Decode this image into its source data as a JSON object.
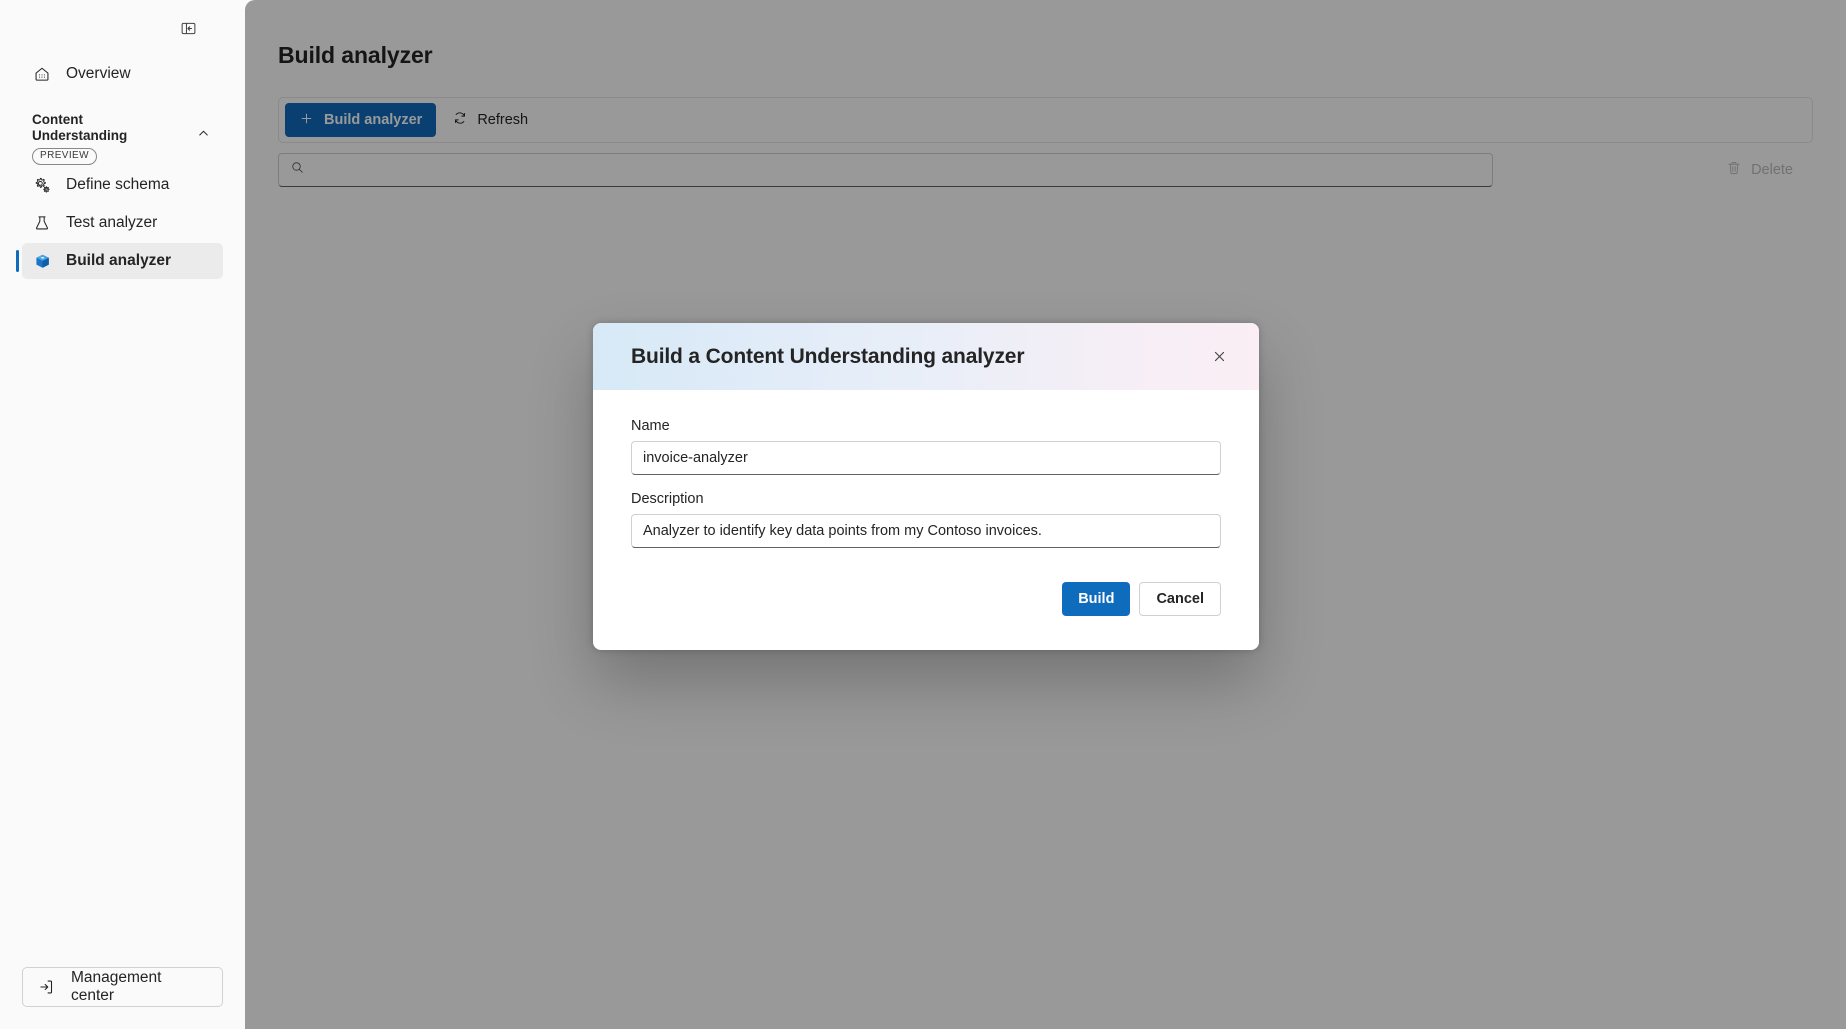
{
  "sidebar": {
    "collapse_icon": "panel-collapse-icon",
    "overview": {
      "label": "Overview",
      "icon": "home-icon"
    },
    "group": {
      "title": "Content Understanding",
      "badge": "PREVIEW",
      "chevron_icon": "chevron-up-icon"
    },
    "items": [
      {
        "label": "Define schema",
        "icon": "settings-gear-icon",
        "selected": false
      },
      {
        "label": "Test analyzer",
        "icon": "beaker-icon",
        "selected": false
      },
      {
        "label": "Build analyzer",
        "icon": "cube-box-icon",
        "selected": true
      }
    ],
    "footer": {
      "label": "Management center",
      "icon": "sign-in-arrow-icon"
    }
  },
  "main": {
    "page_title": "Build analyzer",
    "command_bar": {
      "build_button": {
        "label": "Build analyzer",
        "icon": "plus-icon"
      },
      "refresh_button": {
        "label": "Refresh",
        "icon": "refresh-icon"
      }
    },
    "search": {
      "value": "",
      "placeholder": "",
      "icon": "search-icon"
    },
    "delete_button": {
      "label": "Delete",
      "icon": "trash-icon",
      "disabled": "true"
    }
  },
  "dialog": {
    "title": "Build a Content Understanding analyzer",
    "close_icon": "close-icon",
    "name_field": {
      "label": "Name",
      "value": "invoice-analyzer",
      "placeholder": "Name"
    },
    "description_field": {
      "label": "Description",
      "value": "Analyzer to identify key data points from my Contoso invoices.",
      "placeholder": "Description"
    },
    "build_button_label": "Build",
    "cancel_button_label": "Cancel"
  },
  "colors": {
    "accent": "#0f6cbd",
    "sidebar_bg": "#fafafa",
    "content_bg": "#ffffff",
    "selected_item_bg": "#ebebeb",
    "overlay": "rgba(0,0,0,0.40)",
    "header_gradient_start": "#d7e9f7",
    "header_gradient_end": "#fbeef5"
  }
}
